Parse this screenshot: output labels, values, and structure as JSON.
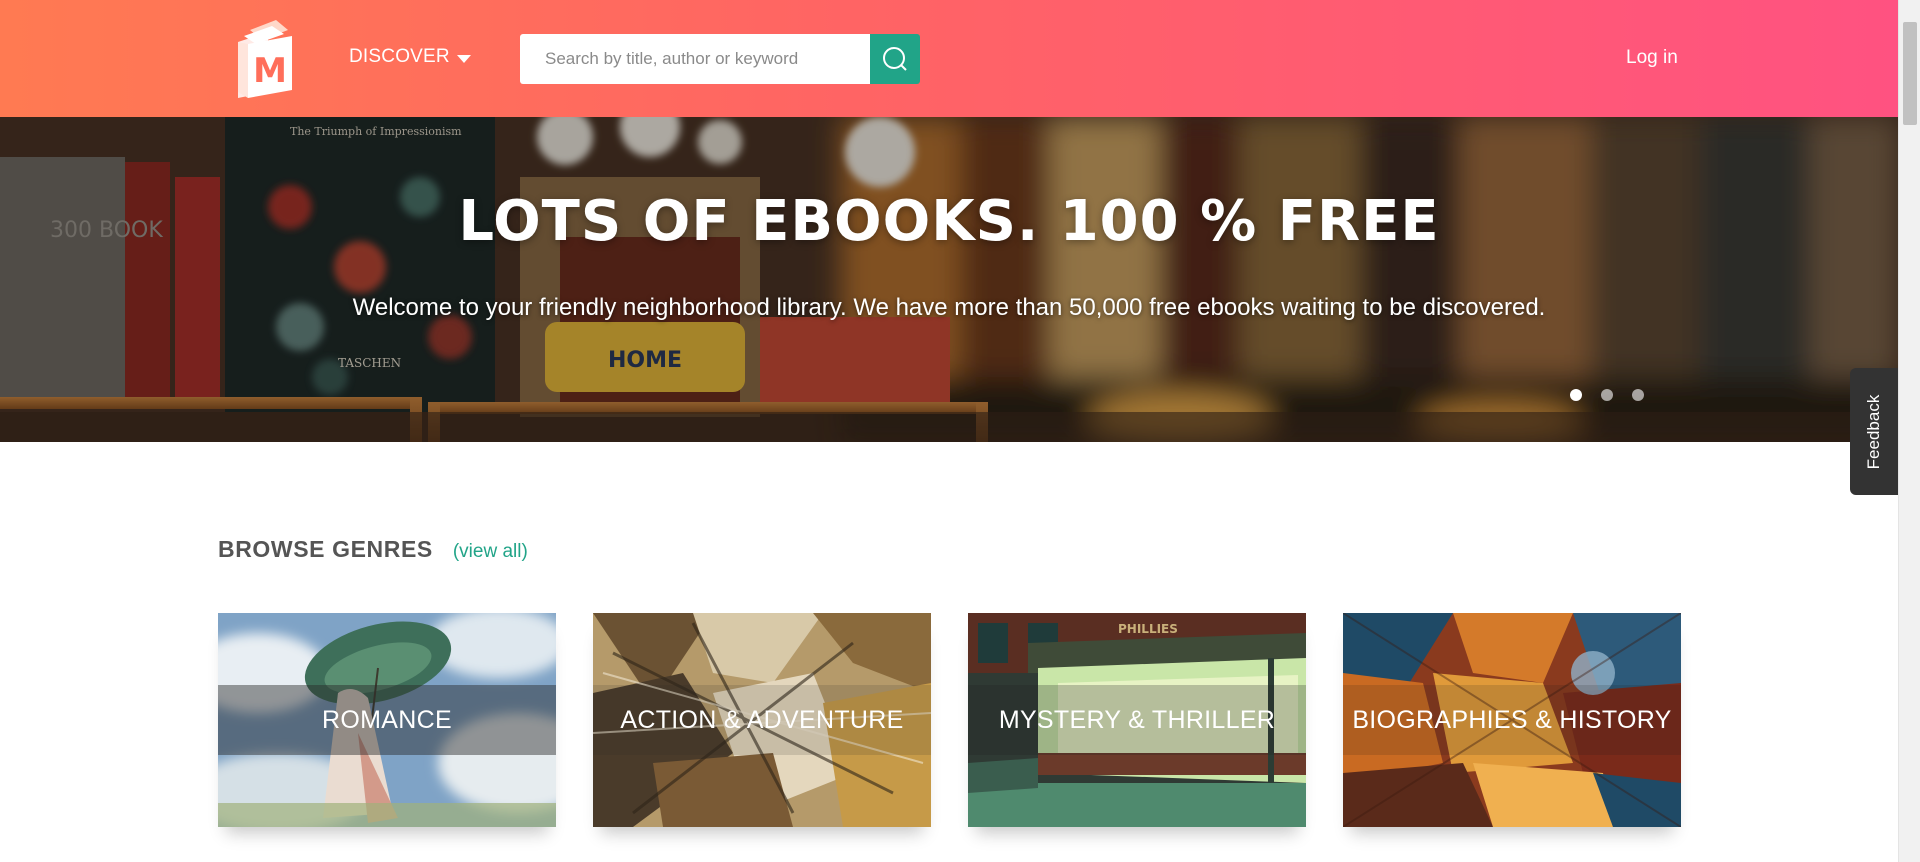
{
  "header": {
    "logo_letter": "M",
    "discover_label": "DISCOVER",
    "search_placeholder": "Search by title, author or keyword",
    "login_label": "Log in"
  },
  "hero": {
    "title": "LOTS OF EBOOKS. 100 % FREE",
    "subtitle": "Welcome to your friendly neighborhood library. We have more than 50,000 free ebooks waiting to be discovered.",
    "book_text_1": "The Triumph of Impressionism",
    "book_text_2": "TASCHEN",
    "book_text_3": "300 BOOK",
    "book_text_4": "HOME",
    "carousel": {
      "slides": 3,
      "active": 1
    }
  },
  "feedback_label": "Feedback",
  "genres": {
    "title": "BROWSE GENRES",
    "view_all": "(view all)",
    "items": [
      {
        "label": "ROMANCE"
      },
      {
        "label": "ACTION & ADVENTURE"
      },
      {
        "label": "MYSTERY & THRILLER"
      },
      {
        "label": "BIOGRAPHIES & HISTORY"
      }
    ],
    "mystery_sign": "PHILLIES"
  },
  "colors": {
    "header_gradient_start": "#ff7a52",
    "header_gradient_end": "#ff5281",
    "accent_green": "#21a488",
    "feedback_bg": "#333333"
  }
}
